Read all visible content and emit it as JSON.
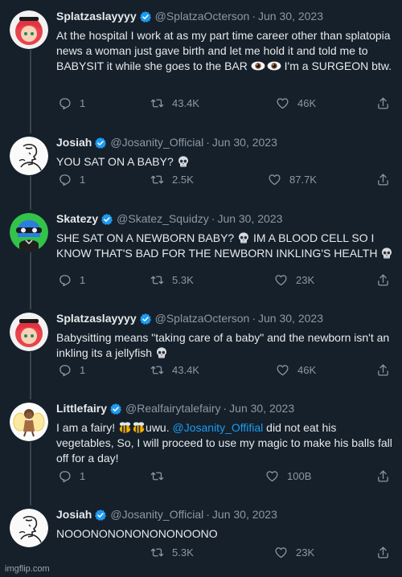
{
  "tweets": [
    {
      "name": "Splatzaslayyyy",
      "handle": "@SplatzaOcterson",
      "date": "Jun 30, 2023",
      "text": "At the hospital I work at as my part time career other than splatopia news a woman just gave birth and let me hold it and told me to BABYSIT it while she goes to the BAR",
      "text_after": "I'm a SURGEON btw.",
      "replies": "1",
      "retweets": "43.4K",
      "likes": "46K"
    },
    {
      "name": "Josiah",
      "handle": "@Josanity_Official",
      "date": "Jun 30, 2023",
      "text": "YOU SAT ON A BABY?",
      "replies": "1",
      "retweets": "2.5K",
      "likes": "87.7K"
    },
    {
      "name": "Skatezy",
      "handle": "@Skatez_Squidzy",
      "date": "Jun 30, 2023",
      "text": "SHE SAT ON A NEWBORN BABY?",
      "text_after": "IM A BLOOD CELL SO I KNOW THAT'S BAD FOR THE NEWBORN INKLING'S HEALTH",
      "replies": "1",
      "retweets": "5.3K",
      "likes": "23K"
    },
    {
      "name": "Splatzaslayyyy",
      "handle": "@SplatzaOcterson",
      "date": "Jun 30, 2023",
      "text": "Babysitting means \"taking care of a baby\" and the newborn isn't an inkling its a jellyfish",
      "replies": "1",
      "retweets": "43.4K",
      "likes": "46K"
    },
    {
      "name": "Littlefairy",
      "handle": "@Realfairytalefairy",
      "date": "Jun 30, 2023",
      "text": "I am a fairy!",
      "text_mid": "uwu.",
      "mention": "@Josanity_Offifial",
      "text_after": "did not eat his vegetables, So, I will proceed to use my magic to make his balls fall off for a day!",
      "replies": "1",
      "retweets": "",
      "likes": "100B"
    },
    {
      "name": "Josiah",
      "handle": "@Josanity_Official",
      "date": "Jun 30, 2023",
      "text": "NOOONONONONONONOONO",
      "replies": "",
      "retweets": "5.3K",
      "likes": "23K"
    }
  ],
  "separator": "·",
  "watermark": "imgflip.com",
  "colors": {
    "background": "#15202b",
    "text": "#e7e9ea",
    "muted": "#8b98a5",
    "verified": "#1d9bf0",
    "mention": "#1d9bf0"
  },
  "icons": [
    "reply-icon",
    "retweet-icon",
    "like-icon",
    "share-icon",
    "verified-badge-icon",
    "skull-emoji-icon",
    "eyes-emoji-icon",
    "bee-emoji-icon"
  ]
}
